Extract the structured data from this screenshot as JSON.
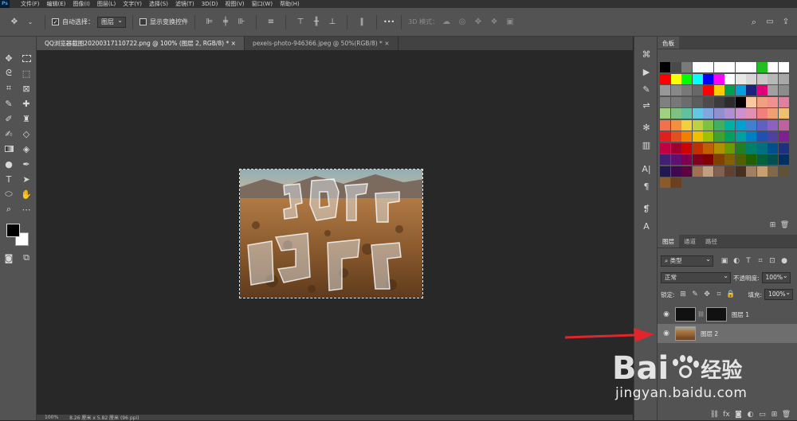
{
  "menubar": {
    "logo": "Ps",
    "items": [
      "文件(F)",
      "编辑(E)",
      "图像(I)",
      "图层(L)",
      "文字(Y)",
      "选择(S)",
      "滤镜(T)",
      "3D(D)",
      "视图(V)",
      "窗口(W)",
      "帮助(H)"
    ]
  },
  "options": {
    "auto_select_label": "自动选择：",
    "auto_select_value": "图层",
    "show_transform_label": "显示变换控件",
    "more_label": "•••",
    "mode_3d_label": "3D 模式："
  },
  "tabs": [
    {
      "label": "QQ浏览器截图20200317110722.png @ 100% (图层 2, RGB/8) *",
      "active": true,
      "close": "×"
    },
    {
      "label": "pexels-photo-946366.jpeg @ 50%(RGB/8) *",
      "active": false,
      "close": "×"
    }
  ],
  "status": {
    "zoom": "100%",
    "doc_info": "8.26 厘米 x 5.82 厘米 (96 ppi)"
  },
  "panels": {
    "swatches_tab": "色板",
    "layers_tabs": [
      "图层",
      "通道",
      "路径"
    ],
    "kind_label": "类型",
    "blend_mode": "正常",
    "opacity_label": "不透明度:",
    "opacity_value": "100%",
    "lock_label": "锁定:",
    "fill_label": "填充:",
    "fill_value": "100%",
    "layers": [
      {
        "name": "图层 1",
        "selected": false
      },
      {
        "name": "图层 2",
        "selected": true
      }
    ]
  },
  "watermark": {
    "brand_pre": "Bai",
    "brand_post": "经验",
    "url": "jingyan.baidu.com"
  },
  "colors": {
    "accent_arrow": "#e0262b",
    "foreground": "#000000",
    "background": "#ffffff"
  },
  "swatches": [
    [
      "#000000",
      "#4a4a4a",
      "#7a7a7a",
      "#ffffff",
      "#ffffff",
      "#ffffff",
      "#ffffff",
      "#ffffff",
      "#ffffff",
      "#20c020",
      "#ffffff",
      "#ffffff"
    ],
    [
      "#ff0000",
      "#ffff00",
      "#00ff00",
      "#00ffff",
      "#0000ff",
      "#ff00ff",
      "#ffffff",
      "#e8e8e8",
      "#d8d8d8",
      "#c8c8c8",
      "#b8b8b8",
      "#a8a8a8"
    ],
    [
      "#989898",
      "#888888",
      "#787878",
      "#686868",
      "#ff0000",
      "#ffcc00",
      "#00a050",
      "#00a0e0",
      "#1a237e",
      "#e00078",
      "#a0a0a0",
      "#8c8c8c"
    ],
    [
      "#808080",
      "#787878",
      "#6c6c6c",
      "#5c5c5c",
      "#4c4c4c",
      "#3c3c3c",
      "#2c2c2c",
      "#000000",
      "#f8c8a0",
      "#f0a080",
      "#f09090",
      "#e080a0"
    ],
    [
      "#a0d080",
      "#80c080",
      "#60c0a0",
      "#60c8e0",
      "#80a8e0",
      "#9090d0",
      "#b090d0",
      "#d090d0",
      "#e090b0",
      "#f08080",
      "#f0a070",
      "#f0c070"
    ],
    [
      "#f07050",
      "#f09040",
      "#f0d040",
      "#c0d040",
      "#80c040",
      "#40b060",
      "#00b0a0",
      "#00a0d0",
      "#4080d0",
      "#6060c0",
      "#9060c0",
      "#c060a0"
    ],
    [
      "#e02020",
      "#e05020",
      "#f08000",
      "#f0c000",
      "#a0c000",
      "#40a030",
      "#00a060",
      "#00a0a0",
      "#0080c0",
      "#2050b0",
      "#5040a0",
      "#802090"
    ],
    [
      "#c00040",
      "#a00030",
      "#d00000",
      "#c03000",
      "#c06000",
      "#b09000",
      "#6a9a00",
      "#208020",
      "#00806a",
      "#007080",
      "#005090",
      "#203080"
    ],
    [
      "#402070",
      "#601070",
      "#800050",
      "#800020",
      "#800000",
      "#804000",
      "#806000",
      "#506000",
      "#206000",
      "#006040",
      "#005050",
      "#003060"
    ],
    [
      "#201850",
      "#400850",
      "#600040",
      "#a07050",
      "#c0a080",
      "#806050",
      "#604030",
      "#483020",
      "#a08060",
      "#c8a070",
      "#806848",
      "#605038"
    ],
    [
      "#8a5a2a",
      "#6a4020"
    ]
  ]
}
